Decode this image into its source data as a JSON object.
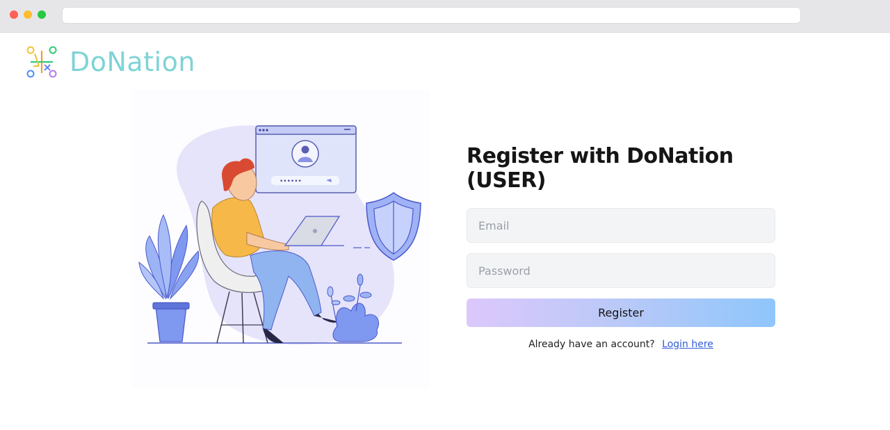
{
  "brand": {
    "name": "DoNation",
    "color": "#7fd3d6"
  },
  "form": {
    "title": "Register with DoNation (USER)",
    "email_placeholder": "Email",
    "password_placeholder": "Password",
    "submit_label": "Register",
    "login_prompt": "Already have an account?",
    "login_link": "Login here"
  },
  "illustration": {
    "password_mask": "••••••"
  },
  "colors": {
    "button_gradient": [
      "#dcc8fb",
      "#8fc6fb"
    ],
    "link": "#2f5bd8"
  }
}
